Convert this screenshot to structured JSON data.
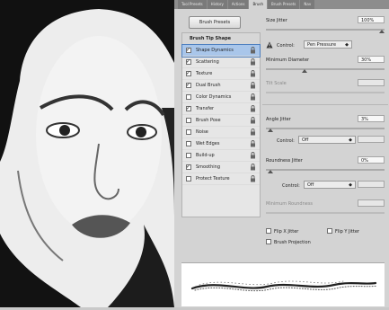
{
  "tabs": [
    "Tool Presets",
    "History",
    "Actions",
    "Brush",
    "Brush Presets",
    "Nav"
  ],
  "brush": {
    "presets_label": "Brush Presets",
    "list": [
      {
        "label": "Brush Tip Shape",
        "checked": false,
        "heading": true,
        "lock": false
      },
      {
        "label": "Shape Dynamics",
        "checked": true,
        "selected": true,
        "lock": true
      },
      {
        "label": "Scattering",
        "checked": true,
        "lock": true
      },
      {
        "label": "Texture",
        "checked": true,
        "lock": true
      },
      {
        "label": "Dual Brush",
        "checked": true,
        "lock": true
      },
      {
        "label": "Color Dynamics",
        "checked": false,
        "lock": true
      },
      {
        "label": "Transfer",
        "checked": true,
        "lock": true
      },
      {
        "label": "Brush Pose",
        "checked": false,
        "lock": true
      },
      {
        "label": "Noise",
        "checked": false,
        "lock": true
      },
      {
        "label": "Wet Edges",
        "checked": false,
        "lock": true
      },
      {
        "label": "Build-up",
        "checked": false,
        "lock": true
      },
      {
        "label": "Smoothing",
        "checked": true,
        "lock": true
      },
      {
        "label": "Protect Texture",
        "checked": false,
        "lock": true
      }
    ],
    "settings": {
      "size_jitter_label": "Size Jitter",
      "size_jitter_value": "100%",
      "control_label": "Control:",
      "control_value": "Pen Pressure",
      "min_diameter_label": "Minimum Diameter",
      "min_diameter_value": "30%",
      "tilt_scale_label": "Tilt Scale",
      "angle_jitter_label": "Angle Jitter",
      "angle_jitter_value": "3%",
      "angle_control_value": "Off",
      "roundness_jitter_label": "Roundness Jitter",
      "roundness_jitter_value": "0%",
      "roundness_control_value": "Off",
      "min_roundness_label": "Minimum Roundness",
      "flip_x_label": "Flip X Jitter",
      "flip_y_label": "Flip Y Jitter",
      "brush_projection_label": "Brush Projection"
    }
  }
}
